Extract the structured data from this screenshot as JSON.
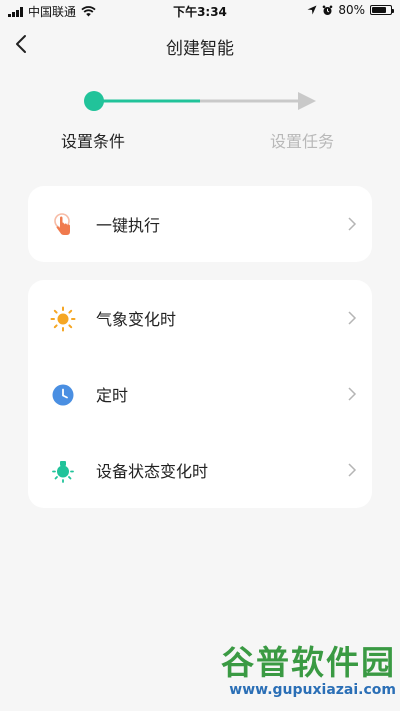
{
  "status_bar": {
    "carrier": "中国联通",
    "time": "下午3:34",
    "battery": "80%",
    "battery_level": 0.8
  },
  "header": {
    "title": "创建智能",
    "back_icon": "chevron-left-icon"
  },
  "stepper": {
    "steps": [
      {
        "label": "设置条件",
        "state": "active"
      },
      {
        "label": "设置任务",
        "state": "inactive"
      }
    ],
    "active_color": "#21c39a",
    "inactive_color": "#c9c9c9"
  },
  "cards": [
    {
      "items": [
        {
          "label": "一键执行",
          "icon": "tap-hand-icon",
          "color": "#f07a4d"
        }
      ]
    },
    {
      "items": [
        {
          "label": "气象变化时",
          "icon": "sun-icon",
          "color": "#f5a623"
        },
        {
          "label": "定时",
          "icon": "clock-icon",
          "color": "#4a8fe2"
        },
        {
          "label": "设备状态变化时",
          "icon": "bulb-icon",
          "color": "#21c39a"
        }
      ]
    }
  ],
  "watermark": {
    "brand": "谷普软件园",
    "url": "www.gupuxiazai.com"
  }
}
